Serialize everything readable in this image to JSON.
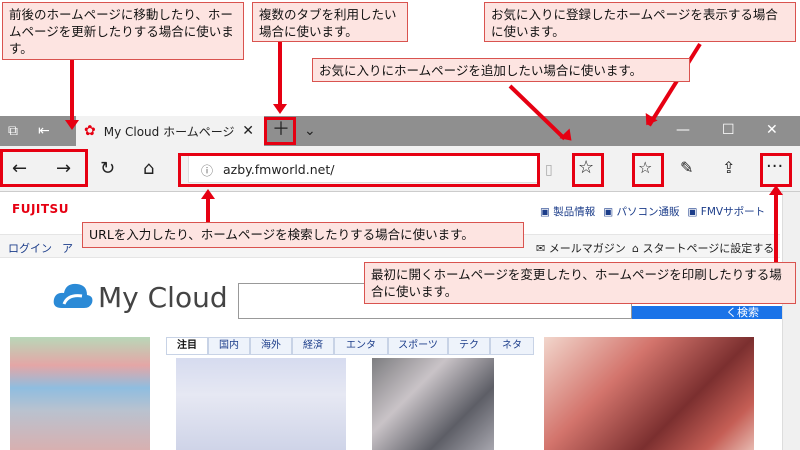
{
  "callouts": {
    "nav": "前後のホームページに移動したり、ホームページを更新したりする場合に使います。",
    "tabs": "複数のタブを利用したい場合に使います。",
    "favorites_show": "お気に入りに登録したホームページを表示する場合に使います。",
    "favorites_add": "お気に入りにホームページを追加したい場合に使います。",
    "url": "URLを入力したり、ホームページを検索したりする場合に使います。",
    "more": "最初に開くホームページを変更したり、ホームページを印刷したりする場合に使います。"
  },
  "browser": {
    "tab_title": "My Cloud ホームページ",
    "url": "azby.fmworld.net/"
  },
  "page": {
    "brand": "FUJITSU",
    "top_links": [
      "製品情報",
      "パソコン通販",
      "FMVサポート"
    ],
    "login": "ログイン",
    "nav_stub": "ア",
    "newsletter": "メールマガジン",
    "startpage": "スタートページに設定する",
    "logo_text": "My Cloud",
    "search_button": "く検索",
    "news_tabs": [
      "注目",
      "国内",
      "海外",
      "経済",
      "エンタ",
      "スポーツ",
      "テク",
      "ネタ"
    ]
  },
  "colors": {
    "accent": "#e60012",
    "callout_bg": "#fde4e1",
    "fujitsu_red": "#e60012",
    "link_blue": "#1c3d8a",
    "search_blue": "#1a73e8"
  }
}
